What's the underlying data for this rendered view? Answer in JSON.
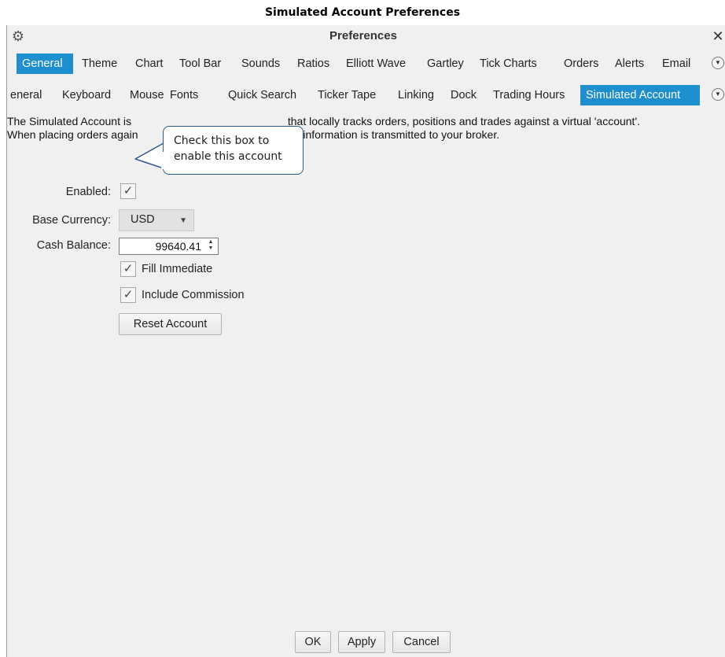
{
  "doc_title": "Simulated Account Preferences",
  "window": {
    "title": "Preferences",
    "close_glyph": "✕",
    "settings_icon": "gear-icon"
  },
  "top_tabs": [
    "General",
    "Theme",
    "Chart",
    "Tool Bar",
    "Sounds",
    "Ratios",
    "Elliott Wave",
    "Gartley",
    "Tick Charts",
    "Orders",
    "Alerts",
    "Email"
  ],
  "top_tab_active": "General",
  "sub_tabs": [
    "eneral",
    "Keyboard",
    "Mouse",
    "Fonts",
    "Quick Search",
    "Ticker Tape",
    "Linking",
    "Dock",
    "Trading Hours",
    "Simulated Account"
  ],
  "sub_tab_active": "Simulated Account",
  "description": {
    "line1_start": "The Simulated Account is ",
    "line1_end": "that locally tracks orders, positions and trades against a virtual 'account'.",
    "line2_start": "When placing orders again",
    "line2_end": "al information is transmitted to your broker."
  },
  "form": {
    "enabled_label": "Enabled:",
    "enabled_checked": true,
    "base_currency_label": "Base Currency:",
    "base_currency_value": "USD",
    "cash_balance_label": "Cash Balance:",
    "cash_balance_value": "99640.41",
    "fill_immediate_label": "Fill Immediate",
    "fill_immediate_checked": true,
    "include_commission_label": "Include Commission",
    "include_commission_checked": true,
    "reset_button": "Reset Account"
  },
  "callout": {
    "line1": "Check this box to",
    "line2": "enable this account"
  },
  "footer": {
    "ok": "OK",
    "apply": "Apply",
    "cancel": "Cancel"
  },
  "colors": {
    "accent": "#1d8fcf",
    "callout_border": "#2e5a8a"
  }
}
